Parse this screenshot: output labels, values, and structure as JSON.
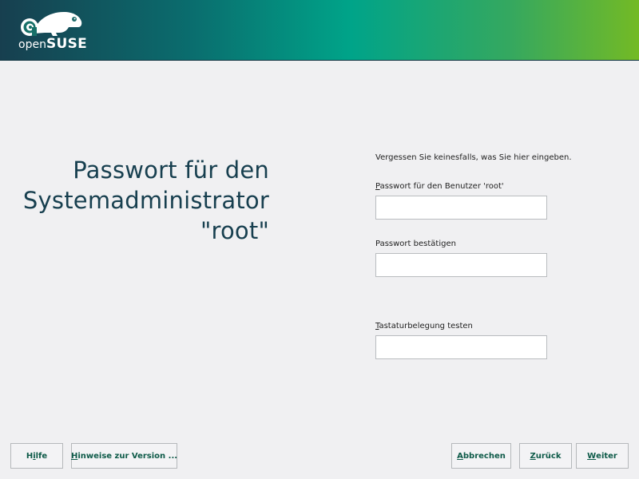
{
  "logo": {
    "text_open": "open",
    "text_suse": "SUSE",
    "icon": "chameleon-logo-icon"
  },
  "page_title": {
    "line1": "Passwort für den",
    "line2": "Systemadministrator",
    "line3": "\"root\""
  },
  "form": {
    "hint": "Vergessen Sie keinesfalls, was Sie hier eingeben.",
    "password": {
      "label_accel": "P",
      "label_rest": "asswort für den Benutzer 'root'",
      "value": ""
    },
    "confirm": {
      "label": "Passwort bestätigen",
      "value": ""
    },
    "keyboard_test": {
      "label_accel": "T",
      "label_rest": "astaturbelegung testen",
      "value": ""
    }
  },
  "buttons": {
    "help": {
      "pre": "H",
      "accel": "i",
      "post": "lfe"
    },
    "release_notes": {
      "pre": "",
      "accel": "H",
      "post": "inweise zur Version ..."
    },
    "abort": {
      "pre": "",
      "accel": "A",
      "post": "bbrechen"
    },
    "back": {
      "pre": "",
      "accel": "Z",
      "post": "urück"
    },
    "next": {
      "pre": "",
      "accel": "W",
      "post": "eiter"
    }
  },
  "colors": {
    "banner_start": "#173f4f",
    "banner_mid": "#00a489",
    "banner_end": "#73ba25",
    "title": "#173f4f",
    "button_text": "#0d5a48",
    "background": "#f0f0f2"
  }
}
